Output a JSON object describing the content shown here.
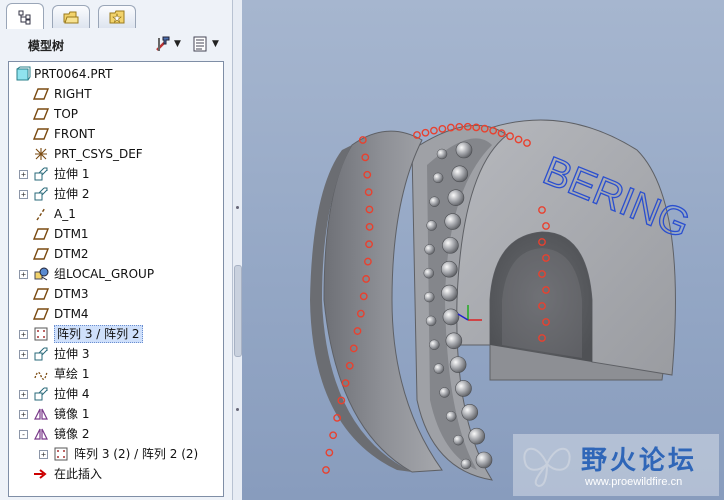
{
  "tabs": [
    {
      "icon": "model-tree-icon"
    },
    {
      "icon": "folder-browser-icon"
    },
    {
      "icon": "favorites-icon"
    }
  ],
  "tree_header": {
    "title": "模型树",
    "settings_icon": "tools-icon",
    "show_icon": "list-icon"
  },
  "tree": [
    {
      "label": "PRT0064.PRT",
      "icon": "part-icon",
      "expander": ""
    },
    {
      "label": "RIGHT",
      "icon": "datum-plane-icon",
      "expander": ""
    },
    {
      "label": "TOP",
      "icon": "datum-plane-icon",
      "expander": ""
    },
    {
      "label": "FRONT",
      "icon": "datum-plane-icon",
      "expander": ""
    },
    {
      "label": "PRT_CSYS_DEF",
      "icon": "csys-icon",
      "expander": ""
    },
    {
      "label": "拉伸 1",
      "icon": "extrude-icon",
      "expander": "+"
    },
    {
      "label": "拉伸 2",
      "icon": "extrude-icon",
      "expander": "+"
    },
    {
      "label": "A_1",
      "icon": "datum-axis-icon",
      "expander": ""
    },
    {
      "label": "DTM1",
      "icon": "datum-plane-icon",
      "expander": ""
    },
    {
      "label": "DTM2",
      "icon": "datum-plane-icon",
      "expander": ""
    },
    {
      "label": "组LOCAL_GROUP",
      "icon": "group-icon",
      "expander": "+"
    },
    {
      "label": "DTM3",
      "icon": "datum-plane-icon",
      "expander": ""
    },
    {
      "label": "DTM4",
      "icon": "datum-plane-icon",
      "expander": ""
    },
    {
      "label": "阵列 3 / 阵列 2",
      "icon": "pattern-icon",
      "expander": "+",
      "selected": true
    },
    {
      "label": "拉伸 3",
      "icon": "extrude-icon",
      "expander": "+"
    },
    {
      "label": "草绘 1",
      "icon": "sketch-icon",
      "expander": ""
    },
    {
      "label": "拉伸 4",
      "icon": "extrude-icon",
      "expander": "+"
    },
    {
      "label": "镜像 1",
      "icon": "mirror-icon",
      "expander": "+"
    },
    {
      "label": "镜像 2",
      "icon": "mirror-icon",
      "expander": "-"
    },
    {
      "label": "阵列 3 (2) / 阵列 2 (2)",
      "icon": "pattern-icon",
      "expander": "+",
      "child": true
    },
    {
      "label": "在此插入",
      "icon": "insert-here-icon",
      "expander": ""
    }
  ],
  "viewport": {
    "model_text": "BERING",
    "bg_top": "#a6b6cf",
    "bg_bottom": "#889cbd",
    "hole_color": "#e8412f"
  },
  "watermark": {
    "title": "野火论坛",
    "url": "www.proewildfire.cn"
  }
}
